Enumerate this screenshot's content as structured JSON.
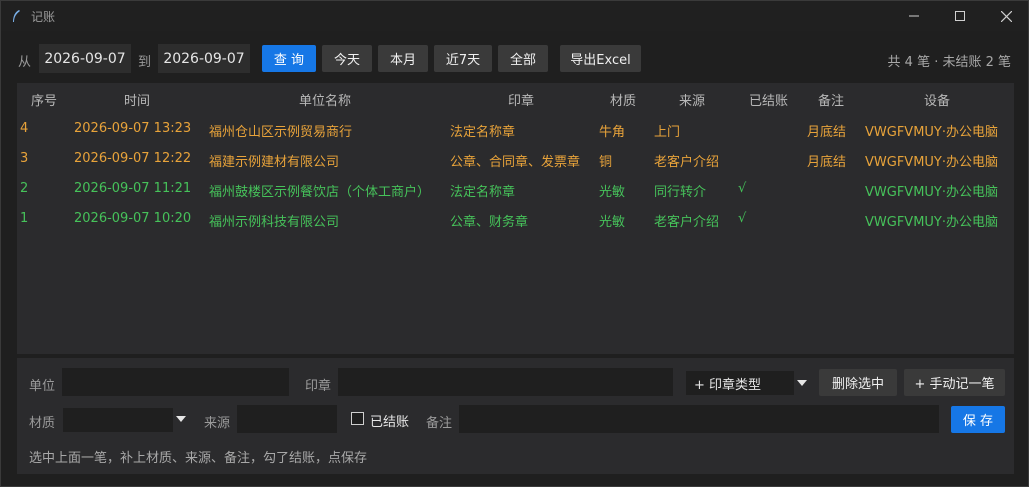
{
  "window": {
    "title": "记账"
  },
  "toolbar": {
    "from_label": "从",
    "date_from": "2026-09-07",
    "to_label": "到",
    "date_to": "2026-09-07",
    "query_label": "查 询",
    "today_label": "今天",
    "month_label": "本月",
    "last7_label": "近7天",
    "all_label": "全部",
    "export_label": "导出Excel",
    "summary": "共 4 笔 · 未结账 2 笔"
  },
  "table": {
    "headers": [
      "序号",
      "时间",
      "单位名称",
      "印章",
      "材质",
      "来源",
      "已结账",
      "备注",
      "设备"
    ],
    "rows": [
      {
        "id": "4",
        "time": "2026-09-07 13:23",
        "company": "福州仓山区示例贸易商行",
        "seal": "法定名称章",
        "material": "牛角",
        "source": "上门",
        "settled": "",
        "note": "月底结",
        "device": "VWGFVMUY·办公电脑",
        "status": "orange"
      },
      {
        "id": "3",
        "time": "2026-09-07 12:22",
        "company": "福建示例建材有限公司",
        "seal": "公章、合同章、发票章",
        "material": "铜",
        "source": "老客户介绍",
        "settled": "",
        "note": "月底结",
        "device": "VWGFVMUY·办公电脑",
        "status": "orange"
      },
      {
        "id": "2",
        "time": "2026-09-07 11:21",
        "company": "福州鼓楼区示例餐饮店（个体工商户）",
        "seal": "法定名称章",
        "material": "光敏",
        "source": "同行转介",
        "settled": "√",
        "note": "",
        "device": "VWGFVMUY·办公电脑",
        "status": "green"
      },
      {
        "id": "1",
        "time": "2026-09-07 10:20",
        "company": "福州示例科技有限公司",
        "seal": "公章、财务章",
        "material": "光敏",
        "source": "老客户介绍",
        "settled": "√",
        "note": "",
        "device": "VWGFVMUY·办公电脑",
        "status": "green"
      }
    ]
  },
  "form": {
    "company_label": "单位",
    "company_value": "",
    "seal_label": "印章",
    "seal_value": "",
    "seal_type_label": "+ 印章类型",
    "delete_label": "删除选中",
    "manual_label": "+ 手动记一笔",
    "material_label": "材质",
    "material_value": "",
    "source_label": "来源",
    "source_value": "",
    "settled_label": "已结账",
    "note_label": "备注",
    "note_value": "",
    "save_label": "保 存",
    "hint": "选中上面一笔，补上材质、来源、备注，勾了结账，点保存"
  },
  "colors": {
    "primary": "#1677e6",
    "unsettled": "#e8a33a",
    "settled": "#46c25a"
  }
}
